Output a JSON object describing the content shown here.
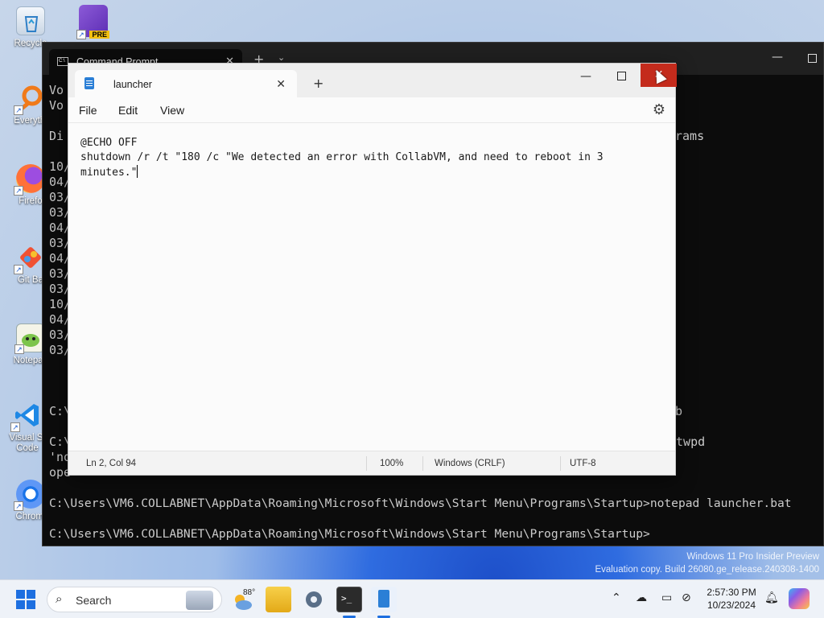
{
  "desktop": {
    "icons": [
      {
        "label": "Recycle"
      },
      {
        "label": "Everythi"
      },
      {
        "label": "Firefo"
      },
      {
        "label": "Git Ba"
      },
      {
        "label": "Notepac"
      },
      {
        "label": "Visual St\nCode"
      },
      {
        "label": "Chromi"
      }
    ],
    "vs_badge": "PRE"
  },
  "cmd": {
    "tab_title": "Command Prompt",
    "left_fragments": [
      "Vo",
      "Vo",
      "Di",
      "10/",
      "04/",
      "03/",
      "03/",
      "04/",
      "03/",
      "04/",
      "03/",
      "03/",
      "10/",
      "04/",
      "03/",
      "03/",
      "C:\\",
      "C:\\",
      "'no",
      "ope"
    ],
    "right_fragments": {
      "programs": "rams",
      "b": "b",
      "twpd": "otwpd"
    },
    "line1": "C:\\Users\\VM6.COLLABNET\\AppData\\Roaming\\Microsoft\\Windows\\Start Menu\\Programs\\Startup>notepad launcher.bat",
    "line2": "C:\\Users\\VM6.COLLABNET\\AppData\\Roaming\\Microsoft\\Windows\\Start Menu\\Programs\\Startup>"
  },
  "notepad": {
    "tab_title": "launcher",
    "menu": {
      "file": "File",
      "edit": "Edit",
      "view": "View"
    },
    "content": "@ECHO OFF\nshutdown /r /t \"180 /c \"We detected an error with CollabVM, and need to reboot in 3\nminutes.\"",
    "status": {
      "position": "Ln 2, Col 94",
      "zoom": "100%",
      "line_ending": "Windows (CRLF)",
      "encoding": "UTF-8"
    }
  },
  "watermark": {
    "line1": "Windows 11 Pro Insider Preview",
    "line2": "Evaluation copy. Build 26080.ge_release.240308-1400"
  },
  "taskbar": {
    "search_label": "Search",
    "weather_temp": "88°",
    "time": "2:57:30 PM",
    "date": "10/23/2024"
  }
}
